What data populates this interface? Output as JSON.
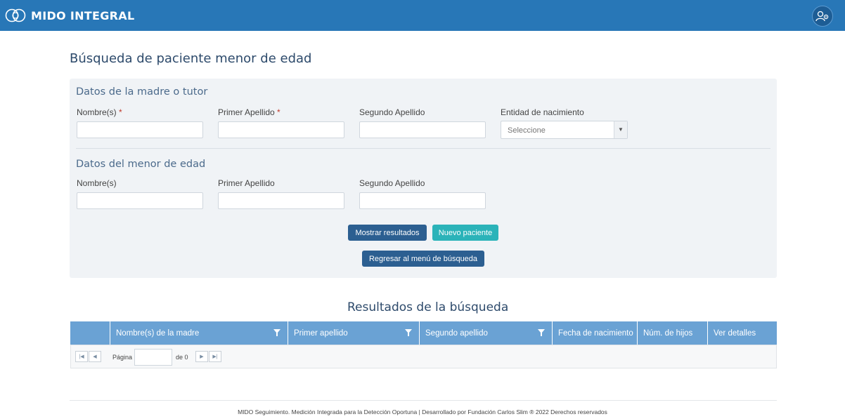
{
  "app": {
    "logo_text": "MIDO INTEGRAL"
  },
  "page": {
    "title": "Búsqueda de paciente menor de edad"
  },
  "mother_section": {
    "title": "Datos de la madre o tutor",
    "nombre_label": "Nombre(s)",
    "primer_apellido_label": "Primer Apellido",
    "segundo_apellido_label": "Segundo Apellido",
    "entidad_label": "Entidad de nacimiento",
    "entidad_placeholder": "Seleccione",
    "required_mark": "*"
  },
  "child_section": {
    "title": "Datos del menor de edad",
    "nombre_label": "Nombre(s)",
    "primer_apellido_label": "Primer Apellido",
    "segundo_apellido_label": "Segundo Apellido"
  },
  "buttons": {
    "mostrar": "Mostrar resultados",
    "nuevo": "Nuevo paciente",
    "regresar": "Regresar al menú de búsqueda"
  },
  "results": {
    "title": "Resultados de la búsqueda",
    "columns": [
      "",
      "Nombre(s) de la madre",
      "Primer apellido",
      "Segundo apellido",
      "Fecha de nacimiento",
      "Núm. de hijos",
      "Ver detalles"
    ],
    "pager": {
      "page_label": "Página",
      "of_label": "de 0"
    }
  },
  "footer": {
    "text": "MIDO Seguimiento. Medición Integrada para la Detección Oportuna | Desarrollado por Fundación Carlos Slim ® 2022 Derechos reservados"
  },
  "colors": {
    "header": "#2877b7",
    "grid_header": "#6aa2d4",
    "button_dark": "#2c5f91",
    "button_teal": "#2bb3b9",
    "required": "#c0392b"
  }
}
